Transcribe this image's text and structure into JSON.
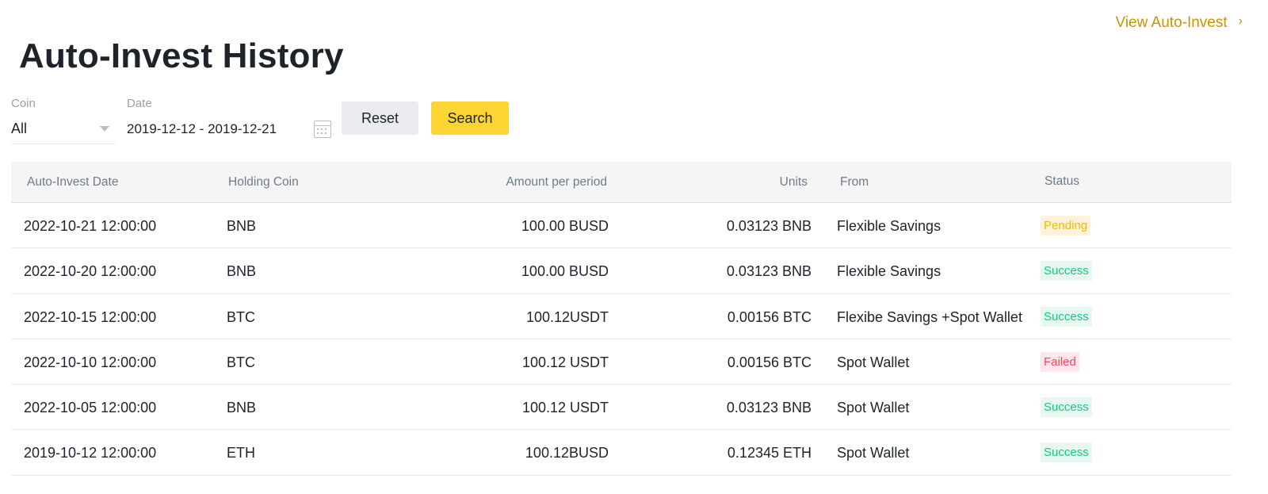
{
  "header": {
    "title": "Auto-Invest History",
    "view_link": "View Auto-Invest",
    "view_link_icon": "chevron-right-icon"
  },
  "filters": {
    "coin_label": "Coin",
    "coin_value": "All",
    "date_label": "Date",
    "date_value": "2019-12-12 - 2019-12-21",
    "reset_label": "Reset",
    "search_label": "Search"
  },
  "table": {
    "columns": [
      "Auto-Invest Date",
      "Holding Coin",
      "Amount per period",
      "Units",
      "From",
      "Status"
    ],
    "rows": [
      {
        "date": "2022-10-21  12:00:00",
        "coin": "BNB",
        "amount": "100.00 BUSD",
        "units": "0.03123 BNB",
        "from": "Flexible Savings",
        "status": "Pending",
        "status_type": "pending"
      },
      {
        "date": "2022-10-20  12:00:00",
        "coin": "BNB",
        "amount": "100.00 BUSD",
        "units": "0.03123 BNB",
        "from": "Flexible Savings",
        "status": "Success",
        "status_type": "success"
      },
      {
        "date": "2022-10-15  12:00:00",
        "coin": "BTC",
        "amount": "100.12USDT",
        "units": "0.00156 BTC",
        "from": "Flexibe Savings +Spot Wallet",
        "status": "Success",
        "status_type": "success"
      },
      {
        "date": "2022-10-10  12:00:00",
        "coin": "BTC",
        "amount": "100.12 USDT",
        "units": "0.00156 BTC",
        "from": "Spot Wallet",
        "status": "Failed",
        "status_type": "failed"
      },
      {
        "date": "2022-10-05  12:00:00",
        "coin": "BNB",
        "amount": "100.12 USDT",
        "units": "0.03123 BNB",
        "from": "Spot Wallet",
        "status": "Success",
        "status_type": "success"
      },
      {
        "date": "2019-10-12  12:00:00",
        "coin": "ETH",
        "amount": "100.12BUSD",
        "units": "0.12345 ETH",
        "from": "Spot Wallet",
        "status": "Success",
        "status_type": "success"
      }
    ]
  },
  "colors": {
    "accent": "#fcd535",
    "link": "#c99400",
    "success": "#0ecb81",
    "pending": "#f0b90b",
    "failed": "#f6465d"
  }
}
